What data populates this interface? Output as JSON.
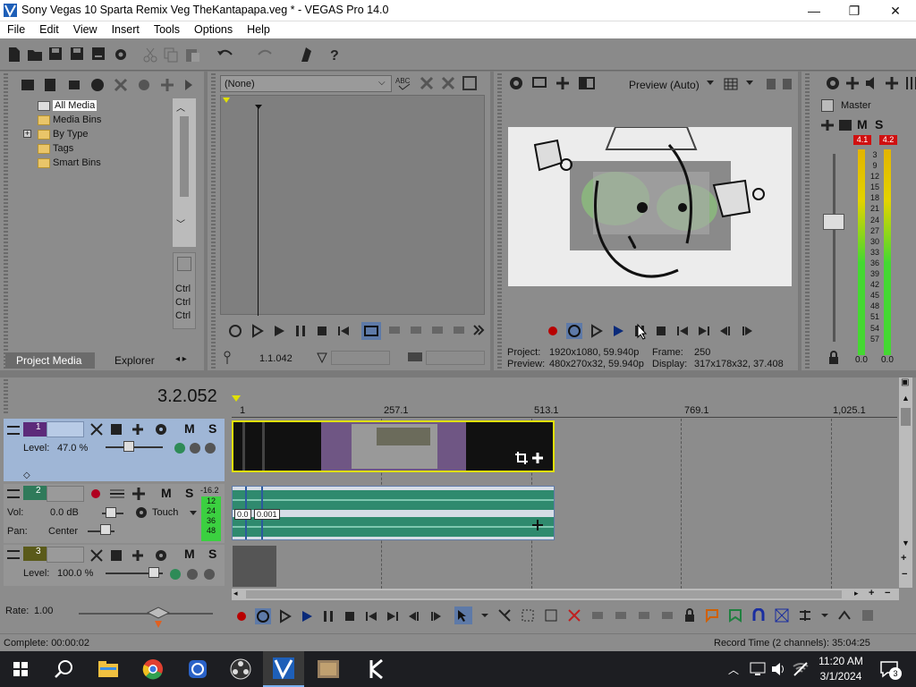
{
  "window": {
    "title": "Sony Vegas 10 Sparta Remix Veg TheKantapapa.veg * - VEGAS Pro 14.0",
    "minimize": "—",
    "maximize": "❐",
    "close": "✕"
  },
  "menu": [
    "File",
    "Edit",
    "View",
    "Insert",
    "Tools",
    "Options",
    "Help"
  ],
  "project_media": {
    "tree": [
      "All Media",
      "Media Bins",
      "By Type",
      "Tags",
      "Smart Bins"
    ],
    "tabs": [
      "Project Media",
      "Explorer"
    ],
    "side_labels": [
      "Ctrl",
      "Ctrl",
      "Ctrl"
    ]
  },
  "trimmer": {
    "dropdown": "(None)",
    "timecode": "1.1.042"
  },
  "preview": {
    "mode": "Preview (Auto)",
    "project_label": "Project:",
    "project_value": "1920x1080, 59.940p",
    "preview_label": "Preview:",
    "preview_value": "480x270x32, 59.940p",
    "frame_label": "Frame:",
    "frame_value": "250",
    "display_label": "Display:",
    "display_value": "317x178x32, 37.408"
  },
  "master": {
    "label": "Master",
    "peak_left": "4.1",
    "peak_right": "4.2",
    "scale": [
      "3",
      "9",
      "12",
      "15",
      "18",
      "21",
      "24",
      "27",
      "30",
      "33",
      "36",
      "39",
      "42",
      "45",
      "48",
      "51",
      "54",
      "57"
    ],
    "bottom_left": "0.0",
    "bottom_right": "0.0"
  },
  "timeline": {
    "time": "3.2.052",
    "ruler": [
      "1",
      "257.1",
      "513.1",
      "769.1",
      "1,025.1"
    ],
    "track1": {
      "num": "1",
      "level": "Level:",
      "level_value": "47.0 %",
      "m": "M",
      "s": "S"
    },
    "track2": {
      "num": "2",
      "vol": "Vol:",
      "vol_value": "0.0 dB",
      "pan": "Pan:",
      "pan_value": "Center",
      "mode": "Touch",
      "meter_top": "-16.2",
      "meter_vals": [
        "12",
        "24",
        "36",
        "48"
      ],
      "m": "M",
      "s": "S",
      "clip_labels": [
        "0.0",
        "0.001"
      ]
    },
    "track3": {
      "num": "3",
      "level": "Level:",
      "level_value": "100.0 %",
      "m": "M",
      "s": "S"
    }
  },
  "transport": {
    "rate_label": "Rate:",
    "rate_value": "1.00"
  },
  "status": {
    "left": "Complete: 00:00:02",
    "right": "Record Time (2 channels): 35:04:25"
  },
  "taskbar": {
    "time": "11:20 AM",
    "date": "3/1/2024",
    "notif": "3"
  }
}
